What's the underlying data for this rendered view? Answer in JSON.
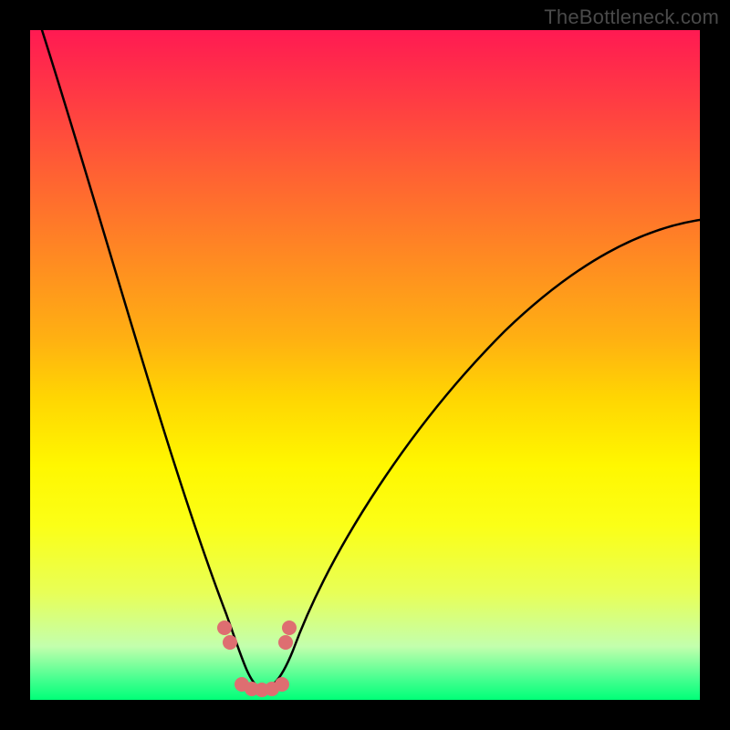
{
  "watermark": {
    "text": "TheBottleneck.com"
  },
  "colors": {
    "frame_bg": "#000000",
    "curve": "#000000",
    "dot_fill": "#de6e71",
    "gradient_top": "#ff1a52",
    "gradient_bottom": "#00ff78"
  },
  "chart_data": {
    "type": "line",
    "title": "",
    "xlabel": "",
    "ylabel": "",
    "xlim": [
      0,
      100
    ],
    "ylim": [
      0,
      100
    ],
    "grid": false,
    "legend": false,
    "annotations": [],
    "series": [
      {
        "name": "curve",
        "x": [
          4,
          6,
          8,
          10,
          12,
          14,
          16,
          18,
          20,
          22,
          24,
          26,
          28,
          30,
          32,
          33,
          34,
          35,
          36,
          37,
          40,
          44,
          48,
          52,
          56,
          60,
          64,
          68,
          72,
          76,
          80,
          84,
          88,
          92,
          96,
          100
        ],
        "y": [
          100,
          93,
          86,
          79,
          72,
          65,
          58,
          51,
          44,
          37,
          30,
          22,
          15,
          9,
          4,
          2.5,
          1.8,
          1.6,
          1.8,
          2.5,
          7,
          15,
          23,
          30,
          37,
          43,
          48,
          53,
          57,
          60.5,
          63.5,
          66,
          68,
          69.5,
          70.7,
          71.5
        ]
      },
      {
        "name": "dots",
        "x": [
          29.3,
          30.2,
          32.0,
          33.5,
          35.0,
          36.5,
          38.0,
          38.6,
          39.1
        ],
        "y": [
          10.8,
          8.6,
          2.3,
          1.6,
          1.5,
          1.6,
          2.3,
          8.6,
          10.8
        ]
      }
    ]
  }
}
